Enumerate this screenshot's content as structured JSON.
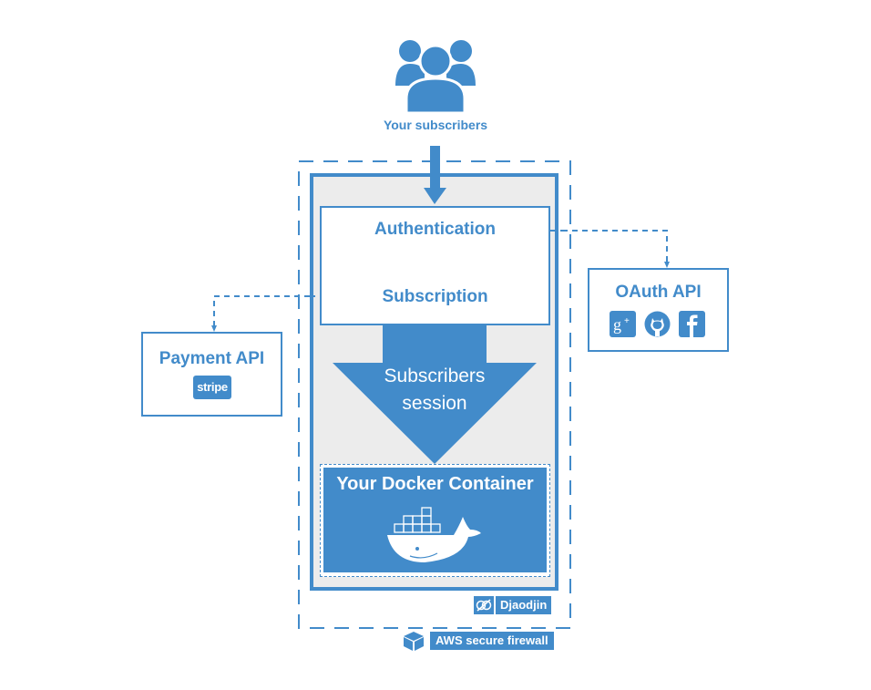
{
  "subscribers": {
    "label": "Your subscribers",
    "icon": "users-icon"
  },
  "auth_box": {
    "authentication_label": "Authentication",
    "subscription_label": "Subscription"
  },
  "session": {
    "line1": "Subscribers",
    "line2": "session"
  },
  "docker": {
    "title": "Your Docker Container",
    "icon": "docker-whale-icon"
  },
  "djaodjin": {
    "label": "Djaodjin",
    "icon": "djaodjin-logo-icon"
  },
  "aws": {
    "label": "AWS secure firewall",
    "icon": "aws-cube-icon"
  },
  "oauth": {
    "title": "OAuth API",
    "providers": [
      {
        "name": "Google+",
        "icon": "google-plus-icon"
      },
      {
        "name": "GitHub",
        "icon": "github-icon"
      },
      {
        "name": "Facebook",
        "icon": "facebook-icon"
      }
    ]
  },
  "payment": {
    "title": "Payment API",
    "provider_logo": "stripe"
  },
  "colors": {
    "accent": "#428bca",
    "panel": "#ececec",
    "background": "#ffffff"
  }
}
